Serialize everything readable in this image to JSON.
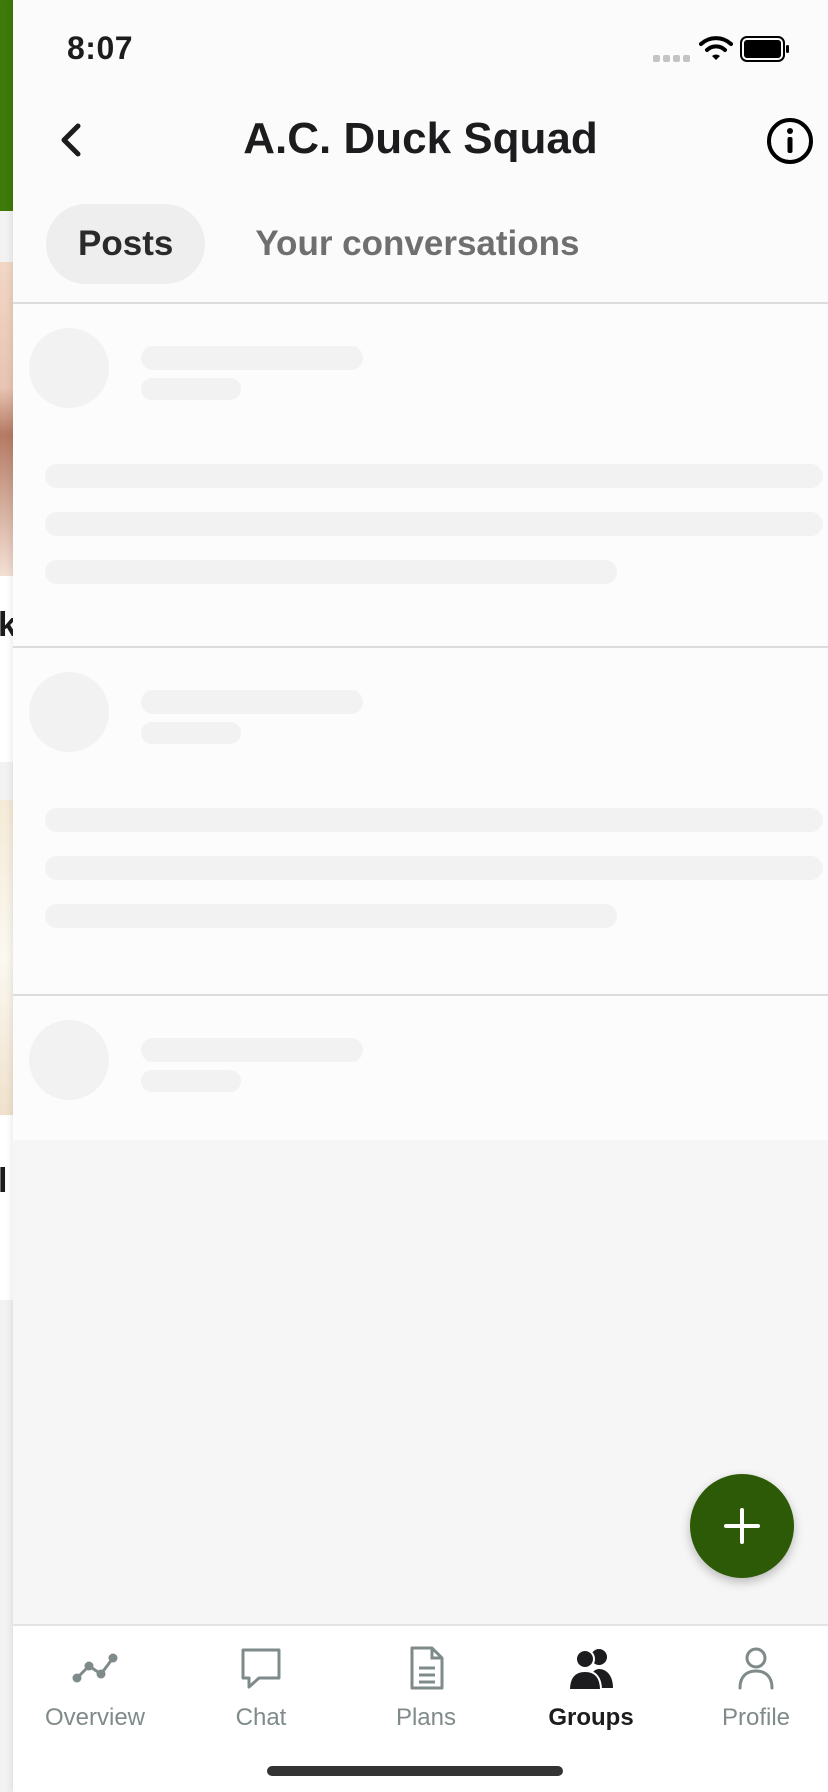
{
  "status_bar": {
    "time": "8:07"
  },
  "header": {
    "title": "A.C. Duck Squad"
  },
  "tabs": [
    {
      "label": "Posts",
      "active": true
    },
    {
      "label": "Your conversations",
      "active": false
    }
  ],
  "background_peek": {
    "glyph_1": "k",
    "glyph_2": "l"
  },
  "fab": {
    "icon": "plus-icon",
    "color": "#2d5a06"
  },
  "bottom_nav": [
    {
      "label": "Overview",
      "icon": "overview-icon",
      "active": false
    },
    {
      "label": "Chat",
      "icon": "chat-icon",
      "active": false
    },
    {
      "label": "Plans",
      "icon": "plans-icon",
      "active": false
    },
    {
      "label": "Groups",
      "icon": "groups-icon",
      "active": true
    },
    {
      "label": "Profile",
      "icon": "profile-icon",
      "active": false
    }
  ],
  "colors": {
    "accent": "#2d5a06",
    "inactive_nav": "#7f8a8a",
    "active_nav": "#1c1c1e"
  }
}
